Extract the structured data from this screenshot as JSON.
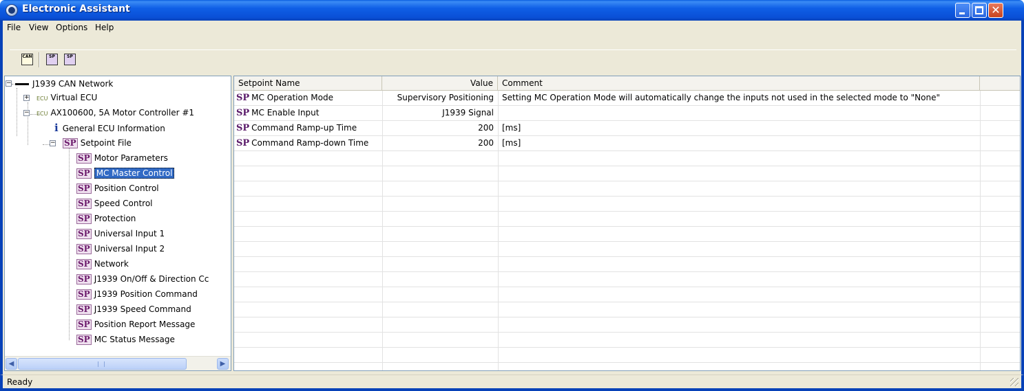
{
  "window": {
    "title": "Electronic Assistant"
  },
  "menu": [
    "File",
    "View",
    "Options",
    "Help"
  ],
  "toolbar": {
    "buttons": [
      {
        "icon": "can-network-icon",
        "label": "CAN"
      },
      {
        "icon": "sp-open-icon",
        "label": "SP"
      },
      {
        "icon": "sp-save-icon",
        "label": "SP"
      }
    ]
  },
  "tree": {
    "root": "J1939 CAN Network",
    "ecu_tag": "ECU",
    "ecu1": "Virtual ECU",
    "ecu2": "AX100600, 5A Motor Controller #1",
    "info": "General ECU Information",
    "setpoint_file": "Setpoint File",
    "sp_badge": "SP",
    "info_glyph": "i",
    "items": [
      "Motor Parameters",
      "MC Master Control",
      "Position Control",
      "Speed Control",
      "Protection",
      "Universal Input 1",
      "Universal Input 2",
      "Network",
      "J1939 On/Off & Direction Cc",
      "J1939 Position Command",
      "J1939 Speed Command",
      "Position Report Message",
      "MC Status Message"
    ],
    "selected": "MC Master Control"
  },
  "grid": {
    "columns": [
      "Setpoint Name",
      "Value",
      "Comment"
    ],
    "rows": [
      {
        "badge": "SP",
        "name": "MC Operation Mode",
        "value": "Supervisory Positioning",
        "comment": "Setting MC Operation Mode will automatically change the inputs not used in the selected mode to \"None\""
      },
      {
        "badge": "SP",
        "name": "MC Enable Input",
        "value": "J1939 Signal",
        "comment": ""
      },
      {
        "badge": "SP",
        "name": "Command Ramp-up Time",
        "value": "200",
        "comment": "[ms]"
      },
      {
        "badge": "SP",
        "name": "Command Ramp-down Time",
        "value": "200",
        "comment": "[ms]"
      }
    ]
  },
  "status": {
    "text": "Ready"
  },
  "colors": {
    "titlebar": "#0a4fd6",
    "selection": "#316ac5",
    "sp_badge": "#6b1a6b"
  }
}
